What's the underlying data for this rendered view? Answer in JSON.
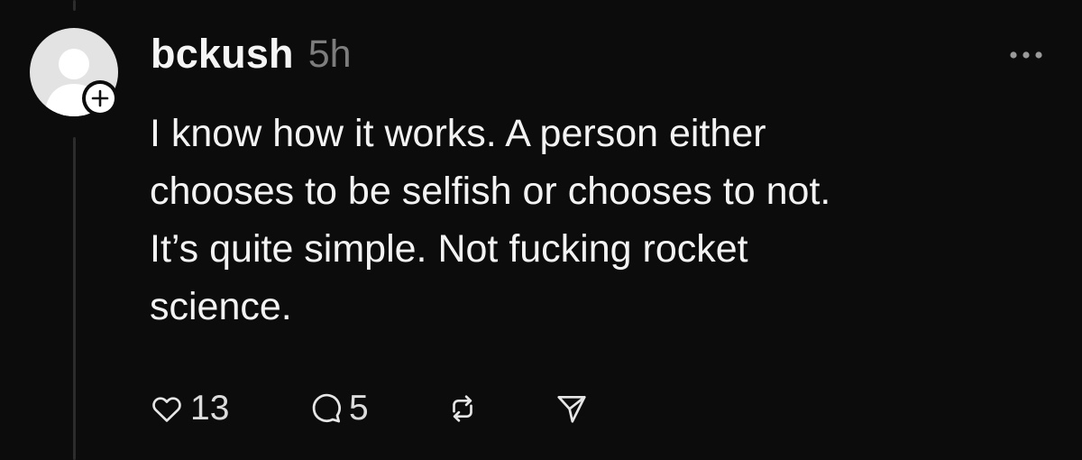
{
  "post": {
    "username": "bckush",
    "timestamp": "5h",
    "text_lines": [
      "I know how it works. A person either",
      "chooses to be selfish or chooses to not.",
      "It’s quite simple. Not fucking rocket",
      "science."
    ],
    "likes": "13",
    "replies": "5"
  },
  "icons": {
    "avatar": "default-avatar-icon",
    "follow": "plus-icon",
    "more": "more-horizontal-icon",
    "like": "heart-icon",
    "reply": "comment-icon",
    "repost": "repost-icon",
    "share": "send-icon"
  },
  "colors": {
    "background": "#0c0c0c",
    "text": "#f3f3f3",
    "muted": "#7d7d7d",
    "thread_line": "#2c2c2c",
    "avatar": "#e3e3e3"
  }
}
